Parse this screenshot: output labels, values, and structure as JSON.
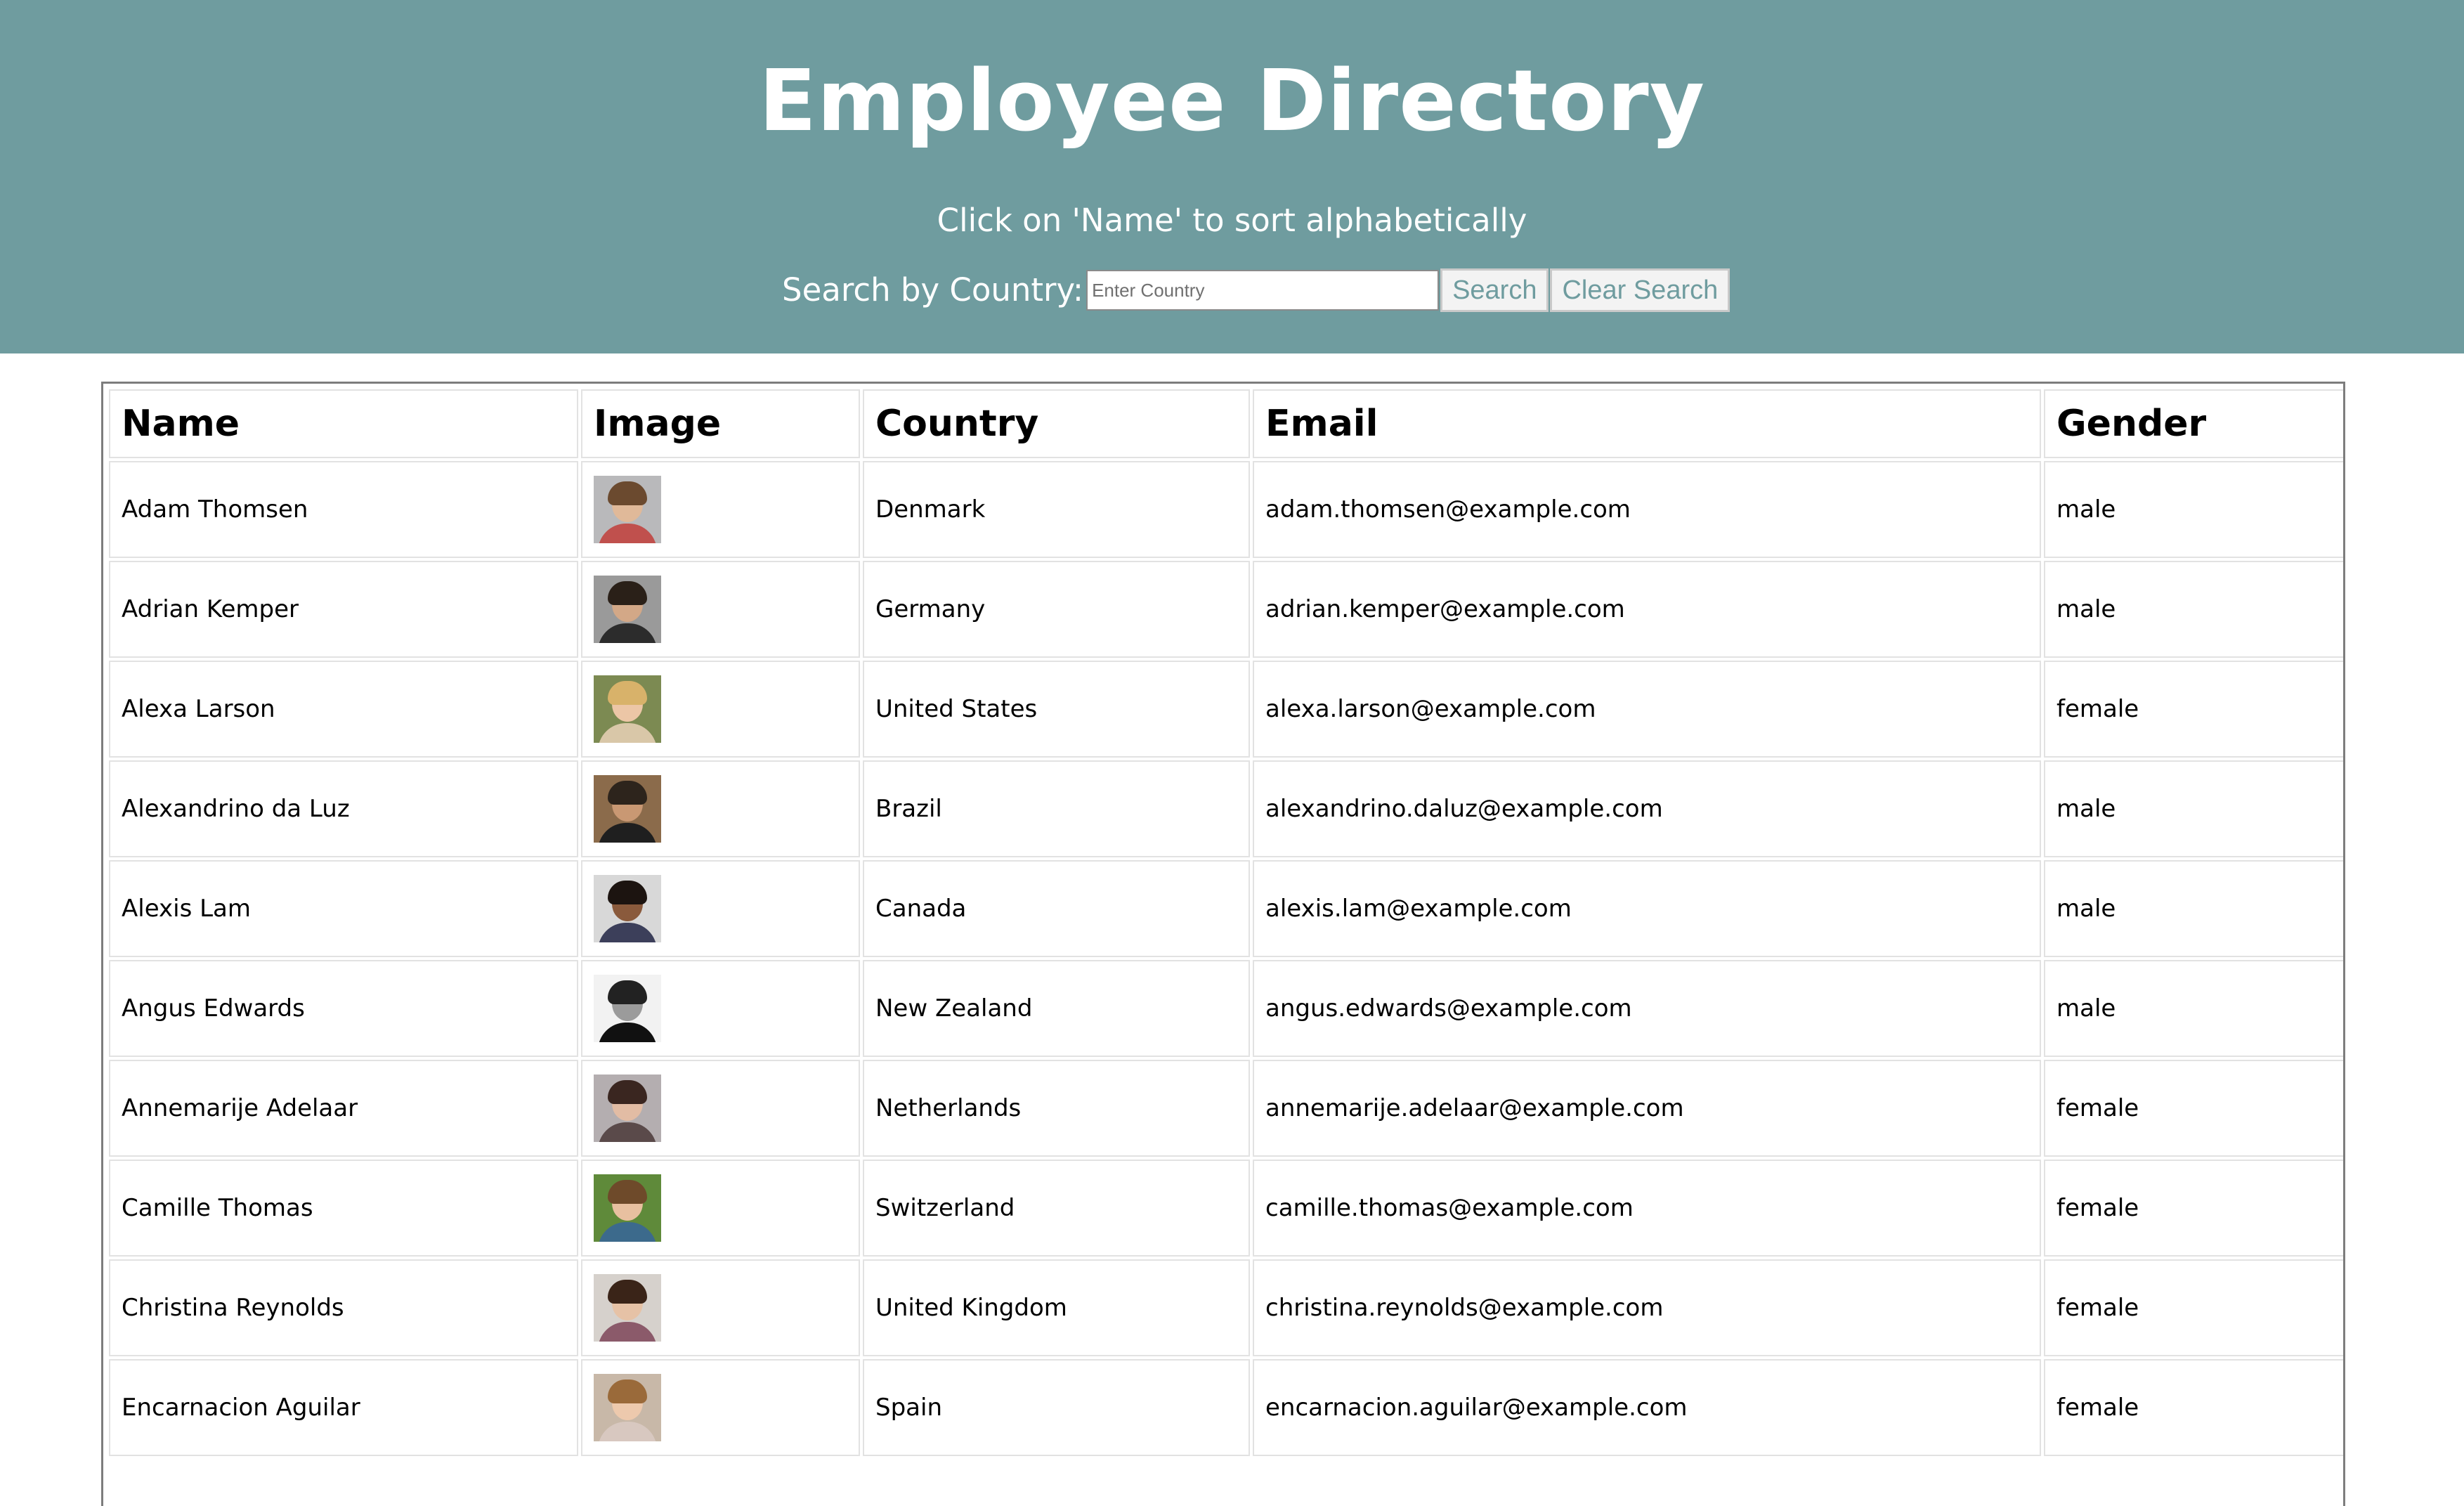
{
  "header": {
    "title": "Employee Directory",
    "subtitle": "Click on 'Name' to sort alphabetically",
    "search_label": "Search by Country:",
    "search_placeholder": "Enter Country",
    "search_value": "",
    "search_button": "Search",
    "clear_button": "Clear Search",
    "background_color": "#6f9c9f"
  },
  "table": {
    "columns": [
      "Name",
      "Image",
      "Country",
      "Email",
      "Gender"
    ],
    "rows": [
      {
        "name": "Adam Thomsen",
        "image": "avatar-photo",
        "country": "Denmark",
        "email": "adam.thomsen@example.com",
        "gender": "male"
      },
      {
        "name": "Adrian Kemper",
        "image": "avatar-photo",
        "country": "Germany",
        "email": "adrian.kemper@example.com",
        "gender": "male"
      },
      {
        "name": "Alexa Larson",
        "image": "avatar-photo",
        "country": "United States",
        "email": "alexa.larson@example.com",
        "gender": "female"
      },
      {
        "name": "Alexandrino da Luz",
        "image": "avatar-photo",
        "country": "Brazil",
        "email": "alexandrino.daluz@example.com",
        "gender": "male"
      },
      {
        "name": "Alexis Lam",
        "image": "avatar-photo",
        "country": "Canada",
        "email": "alexis.lam@example.com",
        "gender": "male"
      },
      {
        "name": "Angus Edwards",
        "image": "avatar-photo",
        "country": "New Zealand",
        "email": "angus.edwards@example.com",
        "gender": "male"
      },
      {
        "name": "Annemarije Adelaar",
        "image": "avatar-photo",
        "country": "Netherlands",
        "email": "annemarije.adelaar@example.com",
        "gender": "female"
      },
      {
        "name": "Camille Thomas",
        "image": "avatar-photo",
        "country": "Switzerland",
        "email": "camille.thomas@example.com",
        "gender": "female"
      },
      {
        "name": "Christina Reynolds",
        "image": "avatar-photo",
        "country": "United Kingdom",
        "email": "christina.reynolds@example.com",
        "gender": "female"
      },
      {
        "name": "Encarnacion Aguilar",
        "image": "avatar-photo",
        "country": "Spain",
        "email": "encarnacion.aguilar@example.com",
        "gender": "female"
      }
    ]
  }
}
